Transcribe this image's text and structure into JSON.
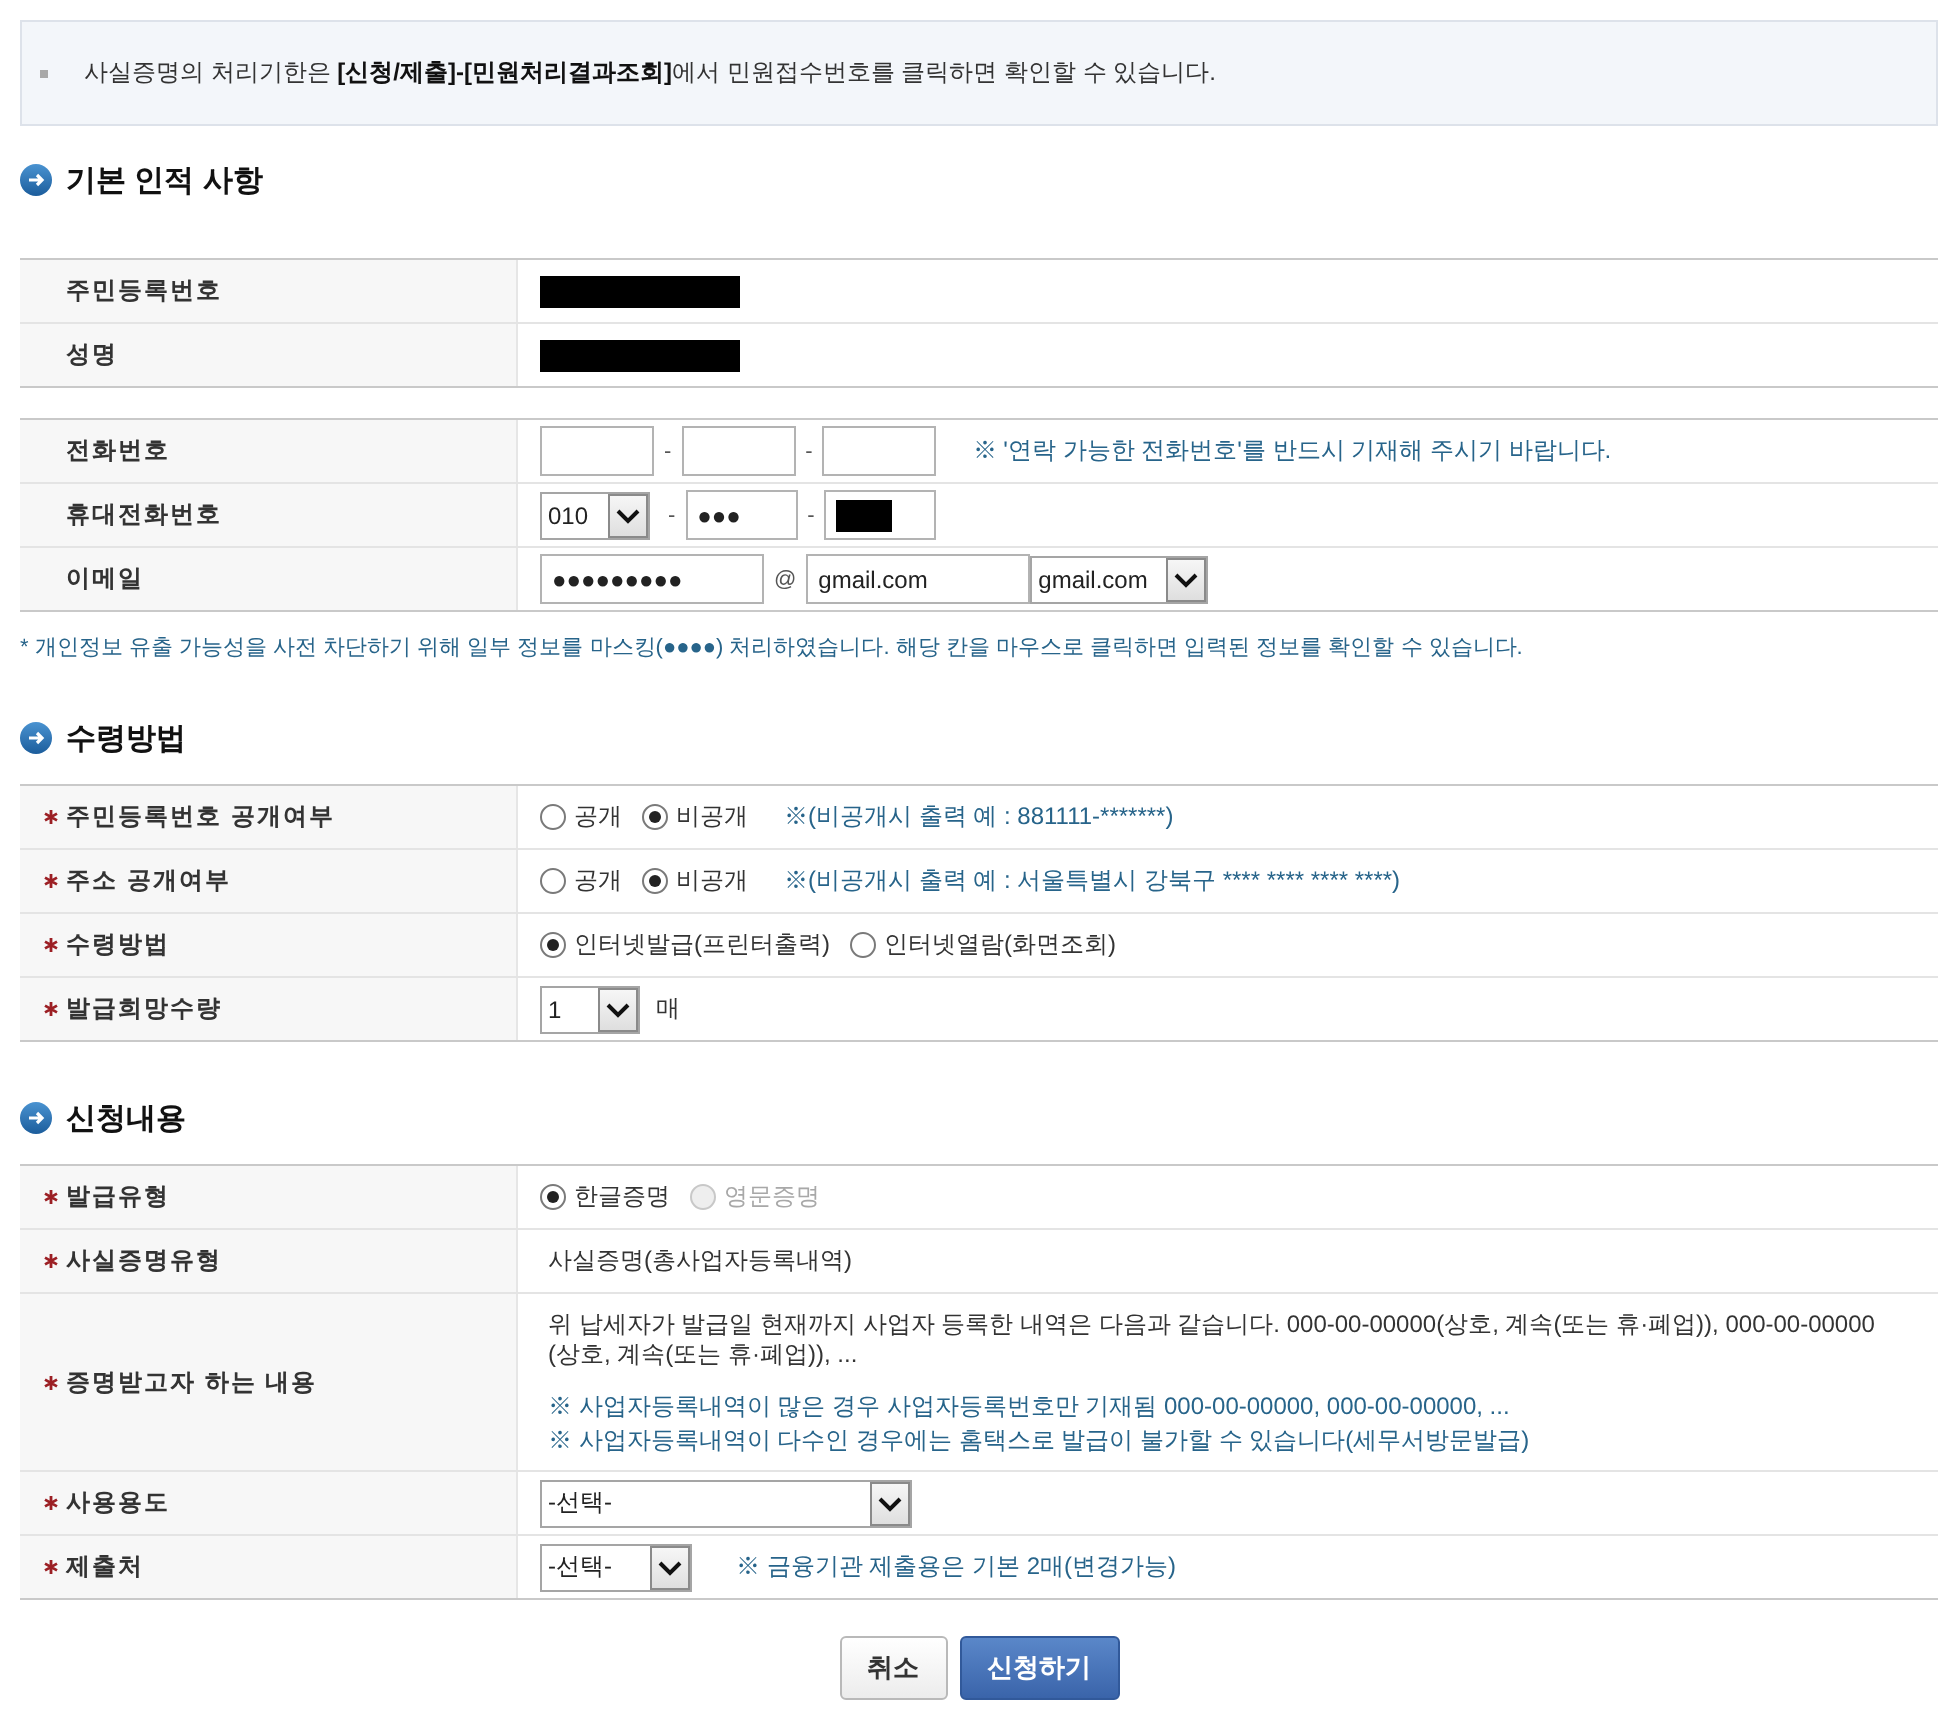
{
  "notice": {
    "text": "사실증명의 처리기한은 **[신청/제출]-[민원처리결과조회]**에서 민원접수번호를 클릭하면 확인할 수 있습니다."
  },
  "sections": [
    {
      "title": "기본 인적 사항",
      "tables": [
        {
          "rows": [
            {
              "kind": "redacted",
              "label": "주민등록번호",
              "required": false,
              "items": [
                {
                  "kind": "redaction"
                }
              ]
            },
            {
              "kind": "redacted",
              "label": "성명",
              "required": false,
              "items": [
                {
                  "kind": "redaction"
                }
              ]
            }
          ]
        },
        {
          "rows": [
            {
              "kind": "phone",
              "label": "전화번호",
              "required": false,
              "items": [
                {
                  "kind": "input",
                  "redacted": false
                },
                {
                  "kind": "sep",
                  "text": "-"
                },
                {
                  "kind": "input",
                  "redacted": false
                },
                {
                  "kind": "sep",
                  "text": "-"
                },
                {
                  "kind": "input",
                  "redacted": false
                },
                {
                  "kind": "note",
                  "text": "※ '연락 가능한 전화번호'를 반드시 기재해 주시기 바랍니다."
                }
              ]
            },
            {
              "kind": "mobile",
              "label": "휴대전화번호",
              "required": false,
              "items": [
                {
                  "kind": "select",
                  "value": "010"
                },
                {
                  "kind": "sep",
                  "text": "-"
                },
                {
                  "kind": "input",
                  "value": "●●●",
                  "redacted": false
                },
                {
                  "kind": "sep",
                  "text": "-"
                },
                {
                  "kind": "input",
                  "redacted": true
                }
              ]
            },
            {
              "kind": "email",
              "label": "이메일",
              "required": false,
              "items": [
                {
                  "kind": "input",
                  "value": "●●●●●●●●●",
                  "redacted": false
                },
                {
                  "kind": "sep",
                  "text": "@"
                },
                {
                  "kind": "input",
                  "value": "gmail.com",
                  "redacted": false
                },
                {
                  "kind": "select",
                  "value": "gmail.com"
                }
              ]
            }
          ]
        }
      ],
      "footnote": "* 개인정보 유출 가능성을 사전 차단하기 위해 일부 정보를 마스킹(●●●●) 처리하였습니다. 해당 칸을 마우스로 클릭하면 입력된 정보를 확인할 수 있습니다."
    },
    {
      "title": "수령방법",
      "tables": [
        {
          "rows": [
            {
              "kind": "radio",
              "label": "주민등록번호 공개여부",
              "required": true,
              "items": [
                {
                  "kind": "radios",
                  "options": [
                    {
                      "label": "공개",
                      "selected": false,
                      "disabled": false
                    },
                    {
                      "label": "비공개",
                      "selected": true,
                      "disabled": false
                    }
                  ]
                },
                {
                  "kind": "note",
                  "text": "※(비공개시 출력 예 : 881111-*******)"
                }
              ]
            },
            {
              "kind": "radio",
              "label": "주소 공개여부",
              "required": true,
              "items": [
                {
                  "kind": "radios",
                  "options": [
                    {
                      "label": "공개",
                      "selected": false,
                      "disabled": false
                    },
                    {
                      "label": "비공개",
                      "selected": true,
                      "disabled": false
                    }
                  ]
                },
                {
                  "kind": "note",
                  "text": "※(비공개시 출력 예 : 서울특별시 강북구 **** **** **** ****)"
                }
              ]
            },
            {
              "kind": "radio",
              "label": "수령방법",
              "required": true,
              "items": [
                {
                  "kind": "radios",
                  "options": [
                    {
                      "label": "인터넷발급(프린터출력)",
                      "selected": true,
                      "disabled": false
                    },
                    {
                      "label": "인터넷열람(화면조회)",
                      "selected": false,
                      "disabled": false
                    }
                  ]
                }
              ]
            },
            {
              "kind": "quantity",
              "label": "발급희망수량",
              "required": true,
              "items": [
                {
                  "kind": "select",
                  "value": "1"
                },
                {
                  "kind": "text",
                  "text": "매"
                }
              ]
            }
          ]
        }
      ]
    },
    {
      "title": "신청내용",
      "tables": [
        {
          "rows": [
            {
              "kind": "radio",
              "label": "발급유형",
              "required": true,
              "items": [
                {
                  "kind": "radios",
                  "options": [
                    {
                      "label": "한글증명",
                      "selected": true,
                      "disabled": false
                    },
                    {
                      "label": "영문증명",
                      "selected": false,
                      "disabled": true
                    }
                  ]
                }
              ]
            },
            {
              "kind": "text",
              "label": "사실증명유형",
              "required": true,
              "items": [
                {
                  "kind": "text",
                  "text": "사실증명(총사업자등록내역)"
                }
              ]
            },
            {
              "kind": "paragraphs",
              "label": "증명받고자 하는 내용",
              "required": true,
              "items": [
                {
                  "kind": "text",
                  "text": "위 납세자가 발급일 현재까지 사업자 등록한 내역은 다음과 같습니다. 000-00-00000(상호, 계속(또는 휴·폐업)), 000-00-00000 (상호, 계속(또는 휴·폐업)), ..."
                },
                {
                  "kind": "note",
                  "text": "※ 사업자등록내역이 많은 경우 사업자등록번호만 기재됨 000-00-00000, 000-00-00000, ..."
                },
                {
                  "kind": "note",
                  "text": "※ 사업자등록내역이 다수인 경우에는 홈택스로 발급이 불가할 수 있습니다(세무서방문발급)"
                }
              ]
            },
            {
              "kind": "purpose",
              "label": "사용용도",
              "required": true,
              "items": [
                {
                  "kind": "select",
                  "value": "-선택-"
                }
              ]
            },
            {
              "kind": "submit",
              "label": "제출처",
              "required": true,
              "items": [
                {
                  "kind": "select",
                  "value": "-선택-"
                },
                {
                  "kind": "note",
                  "text": "※ 금융기관 제출용은 기본 2매(변경가능)"
                }
              ]
            }
          ]
        }
      ]
    }
  ],
  "buttons": [
    {
      "kind": "secondary",
      "label": "취소"
    },
    {
      "kind": "primary",
      "label": "신청하기"
    }
  ]
}
